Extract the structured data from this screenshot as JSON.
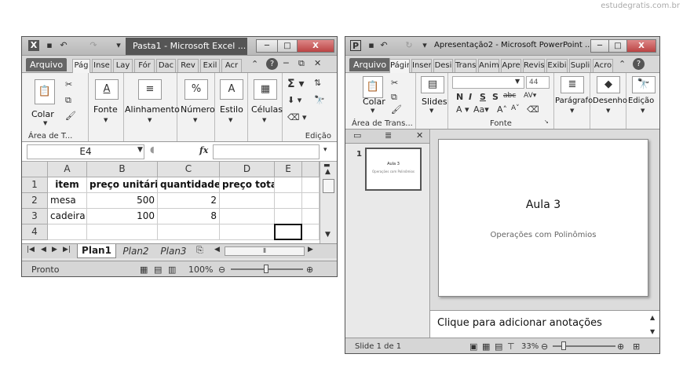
{
  "watermark": "estudegratis.com.br",
  "excel": {
    "title": "Pasta1 - Microsoft Excel ...",
    "app_icon": "X",
    "file_tab": "Arquivo",
    "tabs": [
      "Pág",
      "Inse",
      "Lay",
      "Fór",
      "Dac",
      "Rev",
      "Exil",
      "Acr"
    ],
    "groups": {
      "clipboard": "Área de T...",
      "paste": "Colar",
      "font": "Fonte",
      "alignment": "Alinhamento",
      "number": "Número",
      "style": "Estilo",
      "cells": "Células",
      "editing": "Edição"
    },
    "name_box": "E4",
    "fx": "fx",
    "columns": [
      "A",
      "B",
      "C",
      "D",
      "E"
    ],
    "rows": [
      {
        "n": "1",
        "a": "item",
        "b": "preço unitário",
        "c": "quantidade",
        "d": "preço total"
      },
      {
        "n": "2",
        "a": "mesa",
        "b": "500",
        "c": "2",
        "d": ""
      },
      {
        "n": "3",
        "a": "cadeira",
        "b": "100",
        "c": "8",
        "d": ""
      },
      {
        "n": "4",
        "a": "",
        "b": "",
        "c": "",
        "d": ""
      }
    ],
    "sheets": [
      "Plan1",
      "Plan2",
      "Plan3"
    ],
    "status": "Pronto",
    "zoom": "100%"
  },
  "ppt": {
    "title": "Apresentação2 - Microsoft PowerPoint ...",
    "app_icon": "P",
    "file_tab": "Arquivo",
    "tabs": [
      "Págir",
      "Inser",
      "Desi",
      "Trans",
      "Anim",
      "Apre",
      "Revis",
      "Exibi",
      "Supli",
      "Acro"
    ],
    "groups": {
      "clipboard": "Área de Trans...",
      "paste": "Colar",
      "slides": "Slides",
      "font": "Fonte",
      "paragraph": "Parágrafo",
      "drawing": "Desenho",
      "editing": "Edição"
    },
    "font_size": "44",
    "thumb_num": "1",
    "thumb_title": "Aula 3",
    "thumb_sub": "Operações com Polinômios",
    "slide_title": "Aula 3",
    "slide_sub": "Operações com Polinômios",
    "notes": "Clique para adicionar anotações",
    "status": "Slide 1 de 1",
    "zoom": "33%"
  }
}
